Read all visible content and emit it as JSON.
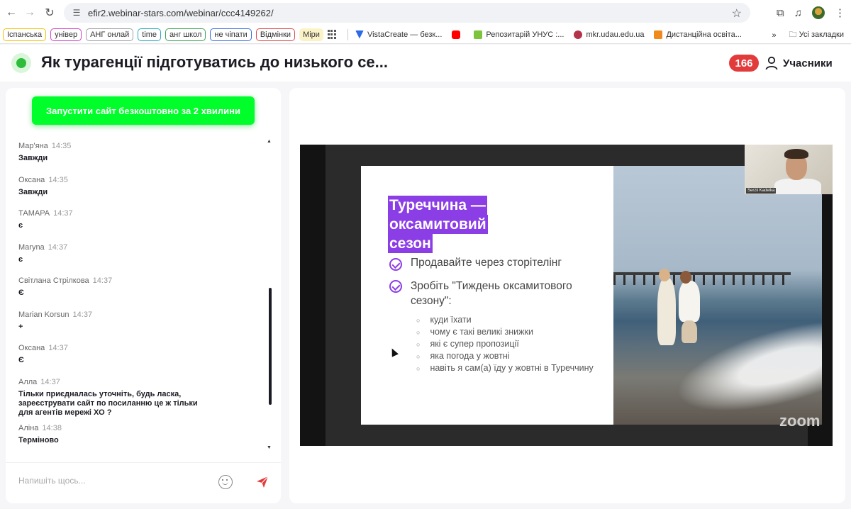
{
  "browser": {
    "url": "efir2.webinar-stars.com/webinar/ccc4149262/",
    "bookmarks_pills": [
      {
        "label": "Іспанська",
        "color": "#f2c200"
      },
      {
        "label": "універ",
        "color": "#d63fc9"
      },
      {
        "label": "АНГ онлай",
        "color": "#9aa0a6"
      },
      {
        "label": "time",
        "color": "#26a8c6"
      },
      {
        "label": "анг школ",
        "color": "#3aa655"
      },
      {
        "label": "не чіпати",
        "color": "#3a6fe0"
      },
      {
        "label": "Відмінки",
        "color": "#e04848"
      },
      {
        "label": "Міри",
        "color": "#f2c200"
      }
    ],
    "bookmarks_links": [
      {
        "label": "VistaCreate — безк...",
        "icon": "vistacreate-icon",
        "color": "#2b6be6"
      },
      {
        "label": "",
        "icon": "youtube-icon",
        "color": "#ff0000"
      },
      {
        "label": "Репозитарій УНУС :...",
        "icon": "repository-icon",
        "color": "#7cc43b"
      },
      {
        "label": "mkr.udau.edu.ua",
        "icon": "mkr-icon",
        "color": "#b5334a"
      },
      {
        "label": "Дистанційна освіта...",
        "icon": "moodle-icon",
        "color": "#f08a1c"
      }
    ],
    "all_bookmarks": "Усі закладки"
  },
  "header": {
    "title": "Як турагенції підготуватись до низького се...",
    "participant_count": "166",
    "participants_label": "Учасники"
  },
  "chat": {
    "promo_button": "Запустити сайт безкоштовно за 2 хвилини",
    "messages": [
      {
        "author": "Мар'яна",
        "time": "14:35",
        "text": "Завжди"
      },
      {
        "author": "Оксана",
        "time": "14:35",
        "text": "Завжди"
      },
      {
        "author": "ТАМАРА",
        "time": "14:37",
        "text": "є"
      },
      {
        "author": "Maryna",
        "time": "14:37",
        "text": "є"
      },
      {
        "author": "Світлана Стрілкова",
        "time": "14:37",
        "text": "Є"
      },
      {
        "author": "Marian Korsun",
        "time": "14:37",
        "text": "+"
      },
      {
        "author": "Оксана",
        "time": "14:37",
        "text": "Є"
      },
      {
        "author": "Алла",
        "time": "14:37",
        "text": "Тільки приєдналась уточніть, будь ласка, зареєструвати сайт по посиланню це ж тільки для агентів мережі ХО ?"
      },
      {
        "author": "Аліна",
        "time": "14:38",
        "text": "Терміново"
      }
    ],
    "input_placeholder": "Напишіть щось..."
  },
  "slide": {
    "title_lines": [
      "Туреччина —",
      "оксамитовий",
      "сезон"
    ],
    "points": [
      "Продавайте через сторітелінг",
      "Зробіть \"Тиждень оксамитового сезону\":"
    ],
    "sub_points": [
      "куди їхати",
      "чому є такі великі знижки",
      "які є супер пропозиції",
      "яка погода у жовтні",
      "навіть я сам(а) їду у жовтні в Туреччину"
    ],
    "accent_color": "#8b3de6"
  },
  "video": {
    "speaker_name": "Serzii Kadeika",
    "watermark": "zoom"
  }
}
